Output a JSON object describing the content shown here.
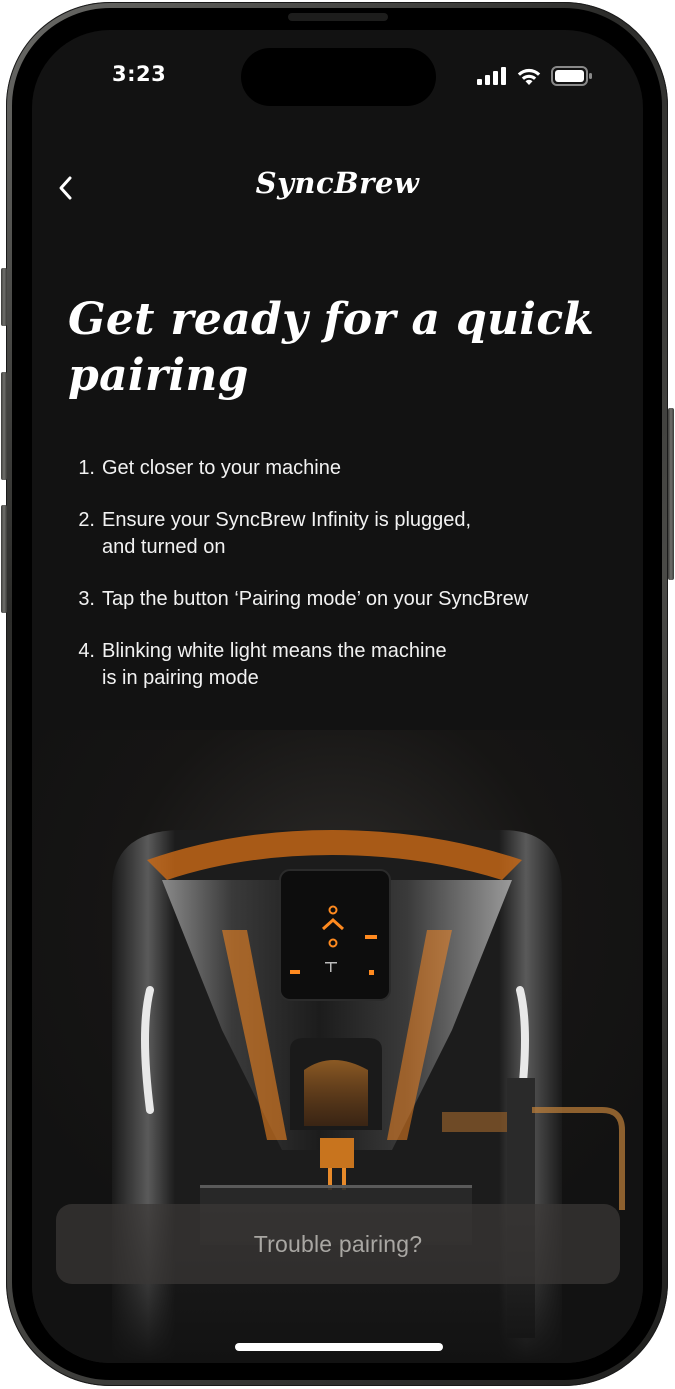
{
  "status_bar": {
    "time": "3:23",
    "icons": [
      "cellular-signal-icon",
      "wifi-icon",
      "battery-icon"
    ]
  },
  "header": {
    "back_icon": "chevron-left-icon",
    "brand": "SyncBrew"
  },
  "main": {
    "headline": "Get ready for a quick pairing",
    "steps": [
      {
        "number": "1.",
        "text": "Get closer to your machine"
      },
      {
        "number": "2.",
        "text": "Ensure your SyncBrew Infinity is plugged,\nand turned on"
      },
      {
        "number": "3.",
        "text": "Tap the button ‘Pairing mode’ on your SyncBrew"
      },
      {
        "number": "4.",
        "text": "Blinking white light means the machine\nis in pairing mode"
      }
    ]
  },
  "hero_image": {
    "subject": "coffee-machine-illustration"
  },
  "footer": {
    "trouble_button_label": "Trouble pairing?"
  },
  "colors": {
    "background": "#121212",
    "text": "#ffffff",
    "accent_orange": "#ff8a1f",
    "button_bg": "#3a3836",
    "button_text": "#a9a7a3"
  }
}
